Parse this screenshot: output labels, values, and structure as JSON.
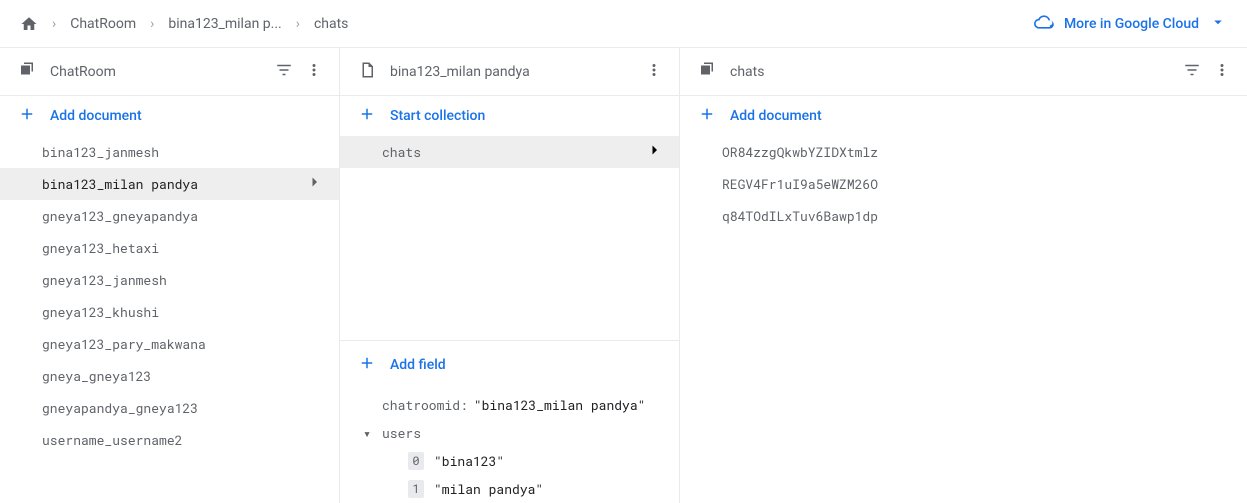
{
  "breadcrumb": {
    "items": [
      "ChatRoom",
      "bina123_milan p...",
      "chats"
    ]
  },
  "cloud_link": {
    "label": "More in Google Cloud"
  },
  "panel1": {
    "title": "ChatRoom",
    "add_label": "Add document",
    "docs": [
      "bina123_janmesh",
      "bina123_milan pandya",
      "gneya123_gneyapandya",
      "gneya123_hetaxi",
      "gneya123_janmesh",
      "gneya123_khushi",
      "gneya123_pary_makwana",
      "gneya_gneya123",
      "gneyapandya_gneya123",
      "username_username2"
    ],
    "selected_index": 1
  },
  "panel2": {
    "title": "bina123_milan pandya",
    "start_label": "Start collection",
    "subcollections": [
      "chats"
    ],
    "add_field_label": "Add field",
    "fields": {
      "chatroomid": {
        "label": "chatroomid",
        "value": "\"bina123_milan pandya\""
      },
      "users": {
        "label": "users",
        "items": [
          "\"bina123\"",
          "\"milan pandya\""
        ]
      }
    }
  },
  "panel3": {
    "title": "chats",
    "add_label": "Add document",
    "docs": [
      "OR84zzgQkwbYZIDXtmlz",
      "REGV4Fr1uI9a5eWZM26O",
      "q84TOdILxTuv6Bawp1dp"
    ]
  }
}
